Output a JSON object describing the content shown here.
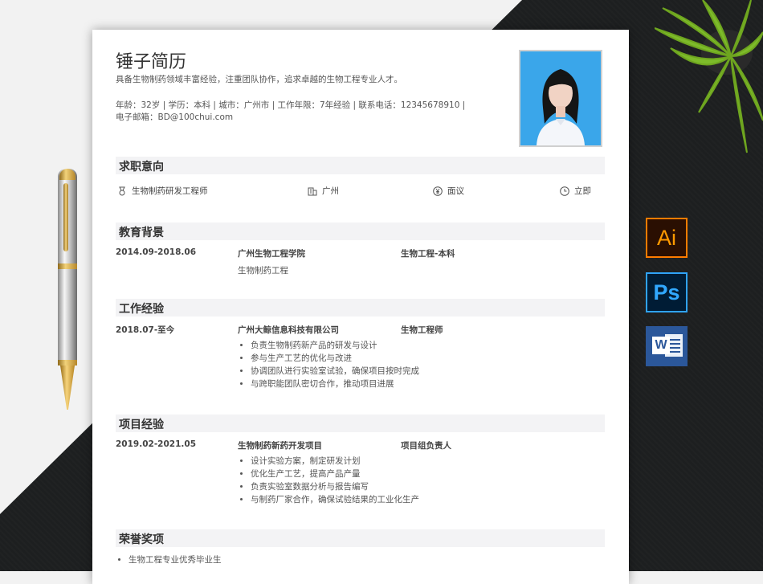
{
  "resume": {
    "name": "锤子简历",
    "summary": "具备生物制药领域丰富经验，注重团队协作，追求卓越的生物工程专业人才。",
    "info_line1": "年龄：32岁 | 学历：本科 | 城市：广州市 | 工作年限：7年经验 | 联系电话：12345678910 |",
    "info_line2": "电子邮箱：BD@100chui.com"
  },
  "sections": {
    "intent": "求职意向",
    "education": "教育背景",
    "work": "工作经验",
    "project": "项目经验",
    "awards": "荣誉奖项"
  },
  "intent": {
    "position": "生物制药研发工程师",
    "city": "广州",
    "salary": "面议",
    "availability": "立即"
  },
  "education": {
    "date": "2014.09-2018.06",
    "school": "广州生物工程学院",
    "degree": "生物工程-本科",
    "major": "生物制药工程"
  },
  "work": {
    "date": "2018.07-至今",
    "company": "广州大鲸信息科技有限公司",
    "role": "生物工程师",
    "bullets": [
      "负责生物制药新产品的研发与设计",
      "参与生产工艺的优化与改进",
      "协调团队进行实验室试验，确保项目按时完成",
      "与跨职能团队密切合作，推动项目进展"
    ]
  },
  "project": {
    "date": "2019.02-2021.05",
    "name": "生物制药新药开发项目",
    "role": "项目组负责人",
    "bullets": [
      "设计实验方案，制定研发计划",
      "优化生产工艺，提高产品产量",
      "负责实验室数据分析与报告编写",
      "与制药厂家合作，确保试验结果的工业化生产"
    ]
  },
  "awards": [
    "生物工程专业优秀毕业生"
  ],
  "apps": {
    "ai_label": "Ai",
    "ps_label": "Ps",
    "word_label": "W"
  },
  "colors": {
    "ai_border": "#ff7c00",
    "ps_border": "#2fa3f7",
    "word_bg": "#2b579a",
    "photo_bg": "#3aa6ea"
  }
}
